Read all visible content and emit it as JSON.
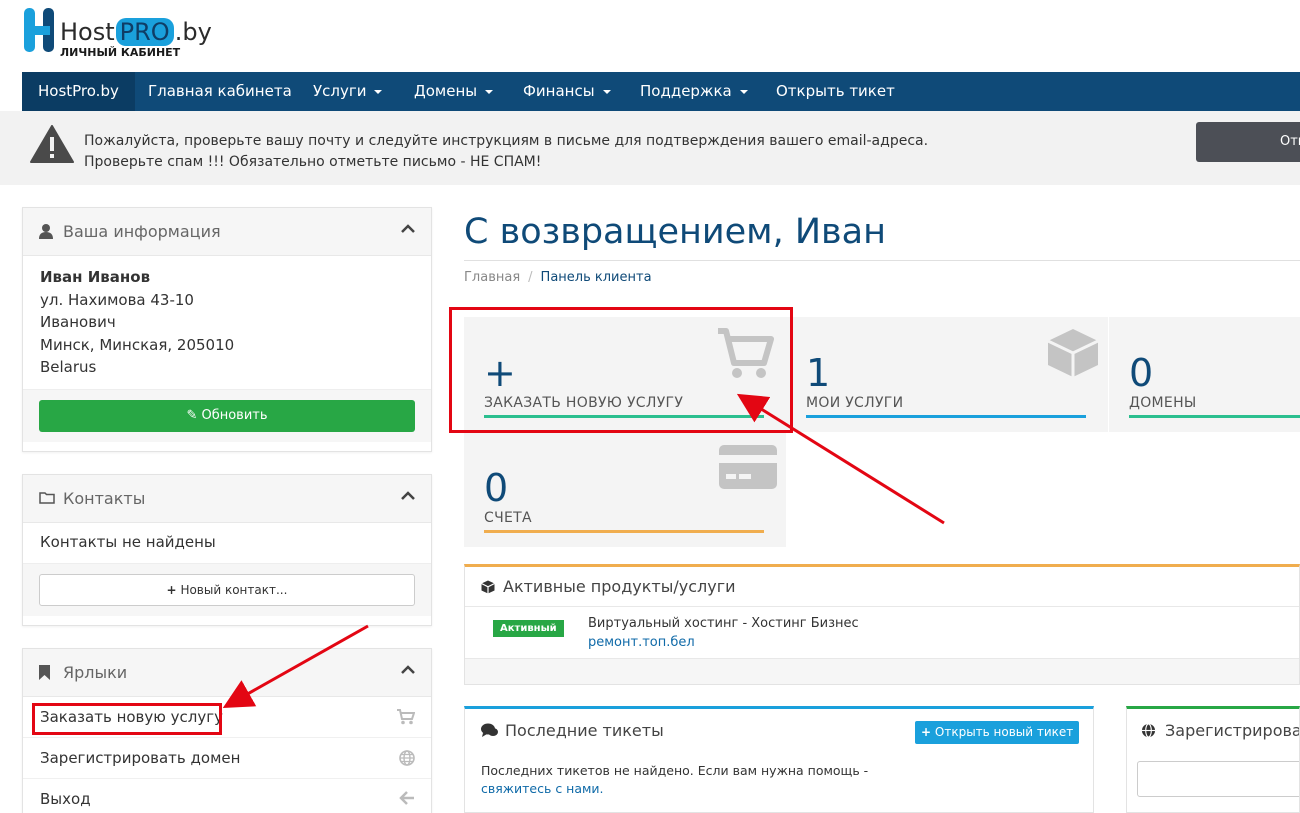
{
  "brand": {
    "name_a": "Host",
    "name_pro": "PRO",
    "name_b": ".by",
    "subtitle": "ЛИЧНЫЙ КАБИНЕТ"
  },
  "nav": {
    "home": "HostPro.by",
    "items": [
      {
        "label": "Главная кабинета"
      },
      {
        "label": "Услуги"
      },
      {
        "label": "Домены"
      },
      {
        "label": "Финансы"
      },
      {
        "label": "Поддержка"
      },
      {
        "label": "Открыть тикет"
      }
    ]
  },
  "alert": {
    "line1": "Пожалуйста, проверьте вашу почту и следуйте инструкциям в письме для подтверждения вашего email-адреса.",
    "line2": "Проверьте спам !!! Обязательно отметьте письмо - НЕ СПАМ!",
    "button": "Отп"
  },
  "sidebar": {
    "info": {
      "title": "Ваша информация",
      "name": "Иван Иванов",
      "address1": "ул. Нахимова 43-10",
      "address2": "Иванович",
      "city": "Минск, Минская, 205010",
      "country": "Belarus",
      "update_button": "Обновить"
    },
    "contacts": {
      "title": "Контакты",
      "empty": "Контакты не найдены",
      "new_button": "Новый контакт..."
    },
    "shortcuts": {
      "title": "Ярлыки",
      "items": [
        {
          "label": "Заказать новую услугу",
          "icon": "cart-icon"
        },
        {
          "label": "Зарегистрировать домен",
          "icon": "globe-icon"
        },
        {
          "label": "Выход",
          "icon": "arrow-left-icon"
        }
      ]
    }
  },
  "main": {
    "welcome": "С возвращением, Иван",
    "breadcrumb": {
      "home": "Главная",
      "current": "Панель клиента"
    },
    "tiles": [
      {
        "value": "+",
        "label": "ЗАКАЗАТЬ НОВУЮ УСЛУГУ",
        "icon": "cart-plus-icon",
        "color": "#2bbf8f"
      },
      {
        "value": "1",
        "label": "МОИ УСЛУГИ",
        "icon": "cube-icon",
        "color": "#1aa0dc"
      },
      {
        "value": "0",
        "label": "ДОМЕНЫ",
        "icon": "globe-icon",
        "color": "#2bbf8f"
      },
      {
        "value": "0",
        "label": "СЧЕТА",
        "icon": "credit-card-icon",
        "color": "#f0ad4e"
      }
    ],
    "products": {
      "title": "Активные продукты/услуги",
      "items": [
        {
          "status": "Активный",
          "name": "Виртуальный хостинг - Хостинг Бизнес",
          "domain": "ремонт.топ.бел"
        }
      ]
    },
    "tickets": {
      "title": "Последние тикеты",
      "open_button": "Открыть новый тикет",
      "empty_text": "Последних тикетов не найдено. Если вам нужна помощь -",
      "empty_link": "свяжитесь с нами."
    },
    "register": {
      "title": "Зарегистрироват"
    }
  },
  "colors": {
    "navbar": "#0f4a78",
    "accent": "#1aa0dc",
    "success": "#28a745",
    "annotation": "#e30613"
  }
}
